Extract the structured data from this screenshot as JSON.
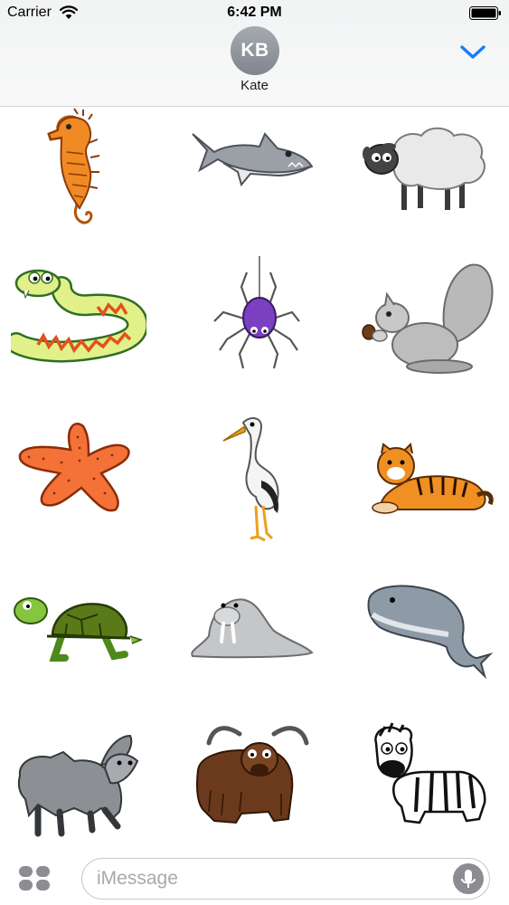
{
  "status_bar": {
    "carrier": "Carrier",
    "time": "6:42 PM",
    "wifi_icon": "wifi-icon",
    "battery_icon": "battery-icon"
  },
  "header": {
    "avatar_initials": "KB",
    "contact_name": "Kate",
    "collapse_icon": "chevron-down-icon",
    "accent_color": "#1a7cf5"
  },
  "stickers": [
    {
      "name": "seahorse"
    },
    {
      "name": "shark"
    },
    {
      "name": "sheep"
    },
    {
      "name": "snake"
    },
    {
      "name": "spider"
    },
    {
      "name": "squirrel"
    },
    {
      "name": "starfish"
    },
    {
      "name": "stork"
    },
    {
      "name": "tiger"
    },
    {
      "name": "turtle"
    },
    {
      "name": "walrus"
    },
    {
      "name": "whale"
    },
    {
      "name": "wolf"
    },
    {
      "name": "yak"
    },
    {
      "name": "zebra"
    }
  ],
  "compose": {
    "placeholder": "iMessage",
    "apps_icon": "app-drawer-icon",
    "mic_icon": "microphone-icon"
  }
}
